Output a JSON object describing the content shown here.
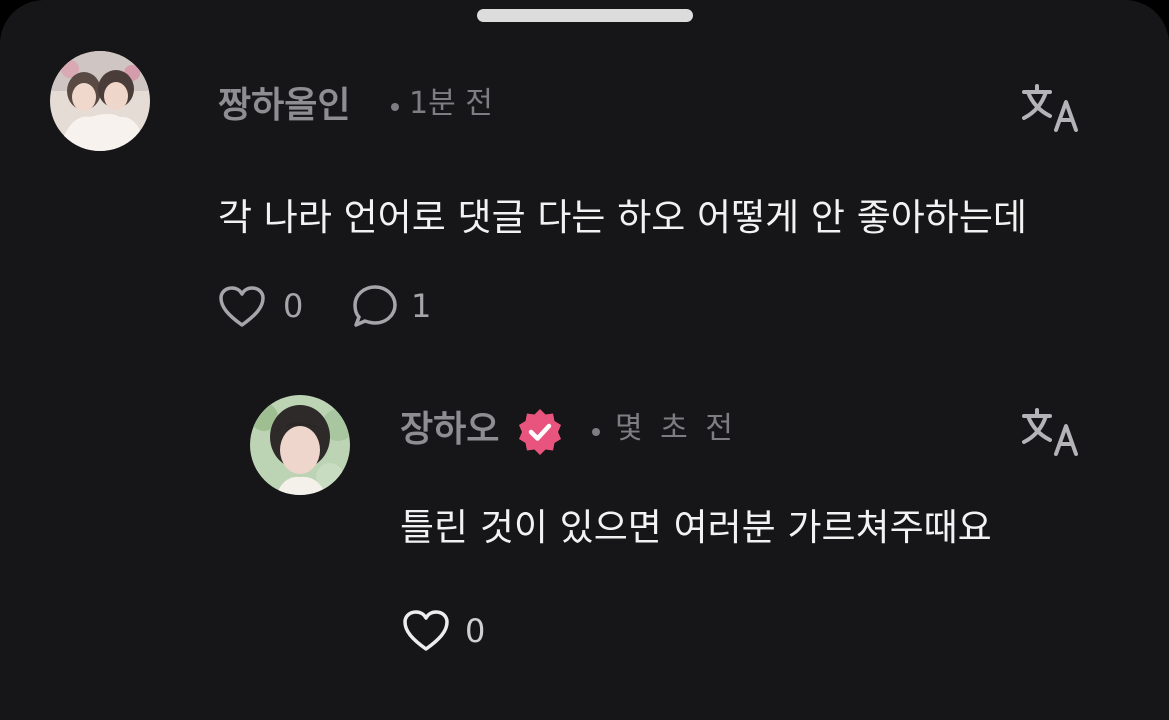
{
  "colors": {
    "sheet": "#161618",
    "text_primary": "#f2f2f2",
    "text_secondary": "#8d8d92",
    "badge": "#e8547e"
  },
  "comment": {
    "username": "짱하올인",
    "time": "1분 전",
    "text": "각 나라 언어로 댓글 다는 하오 어떻게 안 좋아하는데",
    "likes": "0",
    "replies": "1",
    "icons": [
      "heart-icon",
      "comment-icon",
      "translate-icon"
    ]
  },
  "reply": {
    "username": "장하오",
    "verified": true,
    "time": "몇 초 전",
    "text": "틀린 것이 있으면 여러분 가르쳐주때요",
    "likes": "0",
    "icons": [
      "verified-badge-icon",
      "heart-icon",
      "translate-icon"
    ]
  }
}
